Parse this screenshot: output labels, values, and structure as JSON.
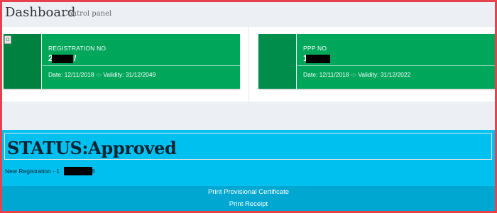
{
  "header": {
    "title": "Dashboard",
    "subtitle": "Control panel"
  },
  "registration_box": {
    "label": "REGISTRATION NO",
    "value_visible": "2",
    "value_tail": "/",
    "date_text": "Date: 12/11/2018 -:- Validity: 31/12/2049",
    "color": "#00a65a"
  },
  "ppp_box": {
    "label": "PPP NO",
    "value_visible": "1",
    "date_text": "Date: 12/11/2018 -:- Validity: 31/12/2022",
    "color": "#00a65a"
  },
  "status": {
    "text": "STATUS:Approved",
    "new_registration_text": "New Registration - 1",
    "new_registration_tail": "8",
    "color": "#00c0ef"
  },
  "footer": {
    "links": [
      {
        "label": "Print Provisional Certificate"
      },
      {
        "label": "Print Receipt"
      }
    ],
    "color": "#00a7d0"
  },
  "icons": {
    "registration_icon": "broken-image-icon"
  }
}
